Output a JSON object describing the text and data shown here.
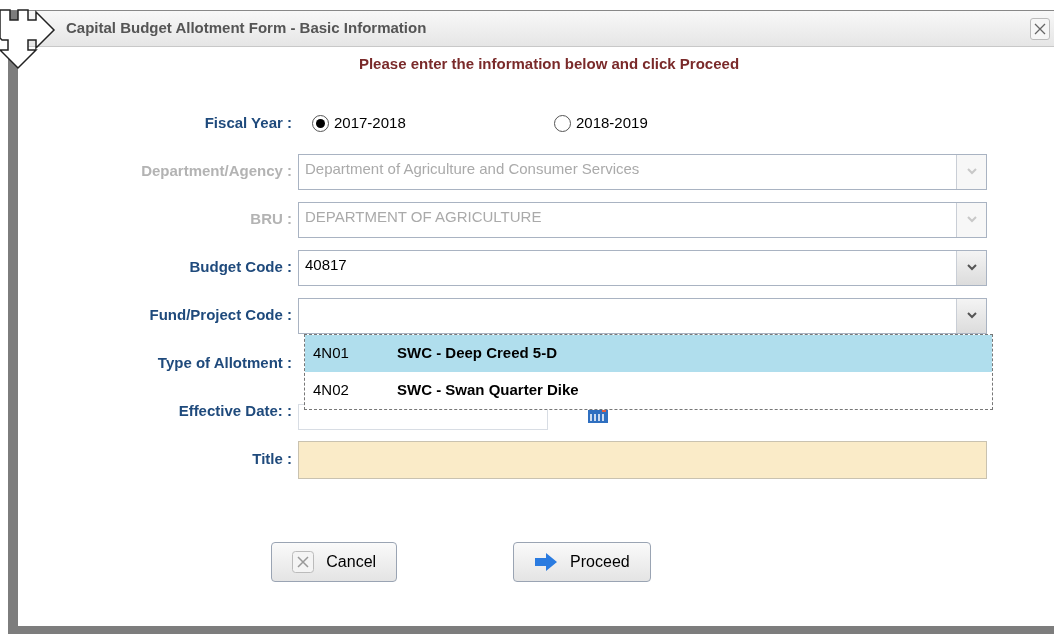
{
  "window": {
    "title": "Capital Budget Allotment Form - Basic Information"
  },
  "instruction": "Please enter the information below and click Proceed",
  "fiscal_year": {
    "label": "Fiscal Year :",
    "options": [
      {
        "label": "2017-2018",
        "selected": true
      },
      {
        "label": "2018-2019",
        "selected": false
      }
    ]
  },
  "fields": [
    {
      "kind": "select",
      "label": "Department/Agency :",
      "value": "Department of Agriculture and Consumer Services",
      "disabled": true
    },
    {
      "kind": "select",
      "label": "BRU :",
      "value": "DEPARTMENT OF AGRICULTURE",
      "disabled": true
    },
    {
      "kind": "select",
      "label": "Budget Code :",
      "value": "40817",
      "disabled": false
    },
    {
      "kind": "dropdown",
      "label": "Fund/Project Code :",
      "disabled": false,
      "options": [
        {
          "code": "4N01",
          "name": "SWC - Deep Creed 5-D",
          "selected": true
        },
        {
          "code": "4N02",
          "name": "SWC - Swan Quarter Dike",
          "selected": false
        }
      ]
    },
    {
      "kind": "hidden",
      "label": "Type of Allotment :"
    },
    {
      "kind": "date",
      "label": "Effective Date:  :"
    },
    {
      "kind": "text",
      "label": "Title :"
    }
  ],
  "buttons": [
    {
      "kind": "cancel",
      "label": "Cancel"
    },
    {
      "kind": "proceed",
      "label": "Proceed"
    }
  ]
}
